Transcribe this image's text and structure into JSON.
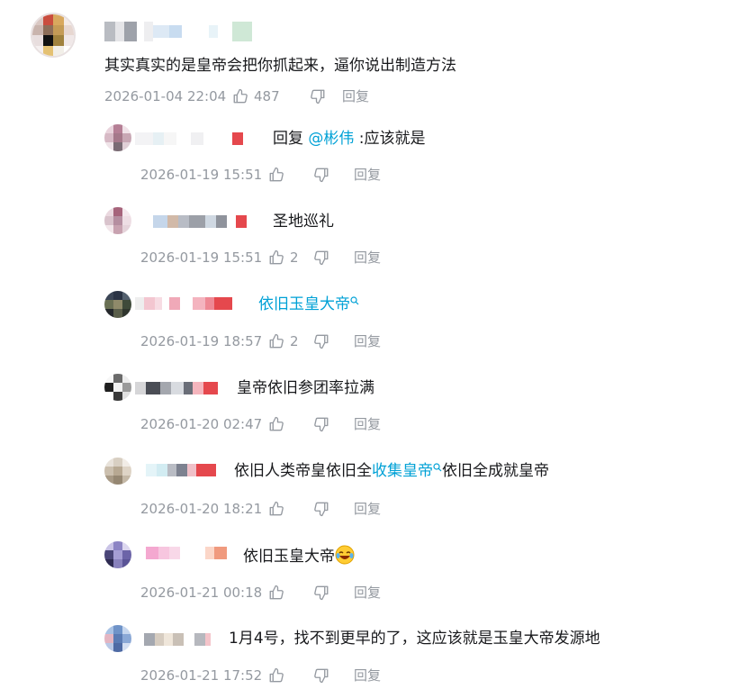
{
  "main_comment": {
    "text": "其实真实的是皇帝会把你抓起来，逼你说出制造方法",
    "time": "2026-01-04 22:04",
    "likes": "487",
    "reply_label": "回复"
  },
  "replies": [
    {
      "prefix": "回复 ",
      "mention": "@彬伟",
      "text": " :应该就是",
      "time": "2026-01-19 15:51",
      "likes": "",
      "reply_label": "回复"
    },
    {
      "text": "圣地巡礼",
      "time": "2026-01-19 15:51",
      "likes": "2",
      "reply_label": "回复"
    },
    {
      "link": "依旧玉皇大帝",
      "time": "2026-01-19 18:57",
      "likes": "2",
      "reply_label": "回复"
    },
    {
      "text": "皇帝依旧参团率拉满",
      "time": "2026-01-20 02:47",
      "likes": "",
      "reply_label": "回复"
    },
    {
      "text_before": "依旧人类帝皇依旧全",
      "link": "收集皇帝",
      "text_after": "依旧全成就皇帝",
      "time": "2026-01-20 18:21",
      "likes": "",
      "reply_label": "回复"
    },
    {
      "text": "依旧玉皇大帝",
      "emoji": "laughing-crying-emoji",
      "time": "2026-01-21 00:18",
      "likes": "",
      "reply_label": "回复"
    },
    {
      "text": "1月4号，找不到更早的了，这应该就是玉皇大帝发源地",
      "time": "2026-01-21 17:52",
      "likes": "",
      "reply_label": "回复"
    }
  ],
  "colors": {
    "text": "#18191c",
    "meta": "#9499a0",
    "link": "#00a1d6"
  },
  "icons": {
    "like": "thumbs-up-icon",
    "dislike": "thumbs-down-icon",
    "search_mark": "search-icon"
  }
}
